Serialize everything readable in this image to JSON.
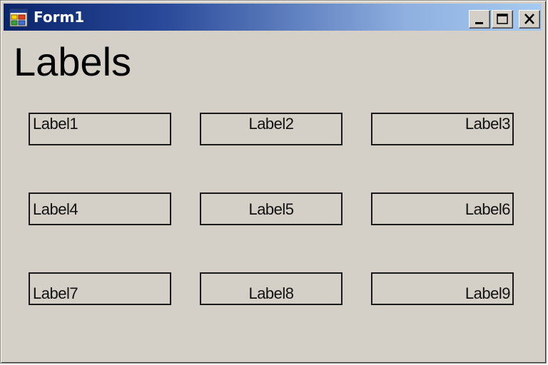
{
  "window": {
    "title": "Form1",
    "controls": {
      "minimize_icon": "minimize-icon",
      "maximize_icon": "maximize-icon",
      "close_icon": "close-icon"
    },
    "app_icon": "application-form-icon"
  },
  "heading": "Labels",
  "labels": [
    {
      "text": "Label1"
    },
    {
      "text": "Label2"
    },
    {
      "text": "Label3"
    },
    {
      "text": "Label4"
    },
    {
      "text": "Label5"
    },
    {
      "text": "Label6"
    },
    {
      "text": "Label7"
    },
    {
      "text": "Label8"
    },
    {
      "text": "Label9"
    }
  ],
  "colors": {
    "form_background": "#d4d0c8",
    "titlebar_start": "#0a246a",
    "titlebar_end": "#a6caf0",
    "title_text": "#ffffff",
    "label_border": "#1a1a1a"
  }
}
